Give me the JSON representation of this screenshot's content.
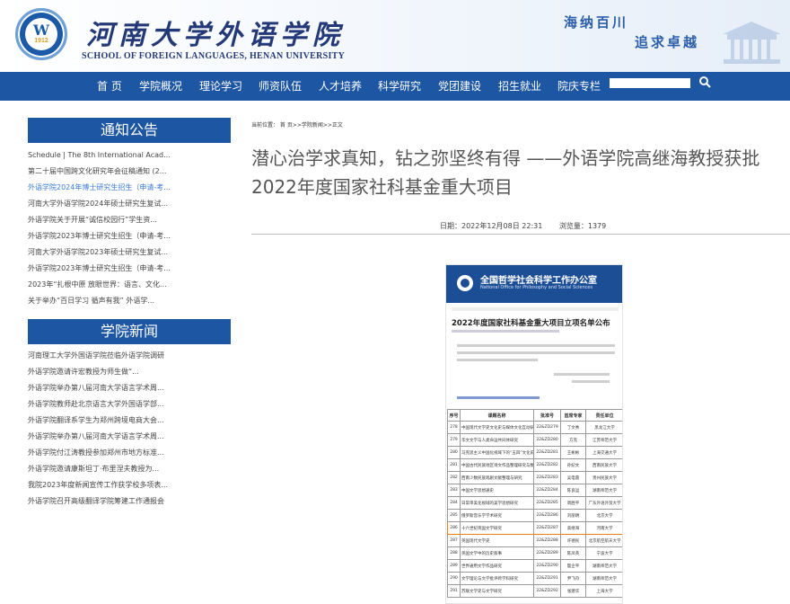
{
  "header": {
    "logo_year": "1912",
    "school_cn": "河南大学外语学院",
    "school_en": "SCHOOL OF FOREIGN LANGUAGES, HENAN UNIVERSITY",
    "slogan_1": "海纳百川",
    "slogan_2": "追求卓越"
  },
  "nav": {
    "items": [
      "首 页",
      "学院概况",
      "理论学习",
      "师资队伍",
      "人才培养",
      "科学研究",
      "党团建设",
      "招生就业",
      "院庆专栏"
    ],
    "search_value": ""
  },
  "sidebar": {
    "notice_title": "通知公告",
    "notices": [
      "Schedule | The 8th International Acad...",
      "第二十届中国跨文化研究年会征稿通知 (2...",
      "外语学院2024年博士研究生招生（申请-考...",
      "河南大学外语学院2024年硕士研究生复试...",
      "外语学院关于开展“诚信校园行”学生资...",
      "外语学院2023年博士研究生招生（申请-考...",
      "河南大学外语学院2023年硕士研究生复试...",
      "外语学院2023年博士研究生招生（申请-考...",
      "2023年“扎根中原 放眼世界：语言、文化...",
      "关于举办“百日学习 循声有我” 外语学..."
    ],
    "active_notice_index": 2,
    "news_title": "学院新闻",
    "news": [
      "河南理工大学外国语学院莅临外语学院调研",
      "外语学院邀请许宏教授为师生做“...",
      "外语学院举办第八届河南大学语言学术周...",
      "外语学院教师赴北京语言大学外国语学部...",
      "外语学院翻译系学生为郑州跨境电商大会...",
      "外语学院举办第八届河南大学语言学术周...",
      "外语学院付江涛教授参加郑州市地方标准...",
      "外语学院邀请康斯坦丁·布里涅夫教授为...",
      "我院2023年度新闻宣传工作获学校多项表...",
      "外语学院召开高级翻译学院筹建工作通报会"
    ]
  },
  "article": {
    "breadcrumb": "当前位置： 首 页>>学院新闻>>正文",
    "title": "潜心治学求真知，钻之弥坚终有得 ——外语学院高继海教授获批2022年度国家社科基金重大项目",
    "date": "日期：2022年12月08日 22:31",
    "views": "浏览量：1379"
  },
  "document": {
    "org": "全国哲学社会科学工作办公室",
    "org_en": "National Office for Philosophy and Social Sciences",
    "title": "2022年度国家社科基金重大项目立项名单公布",
    "headers": [
      "序号",
      "课题名称",
      "批准号",
      "首席专家",
      "责任单位"
    ],
    "rows": [
      [
        "278",
        "中国现代文学史文化史与媒体文化互动研究",
        "22&ZD279",
        "丁文秀",
        "黑龙江大学"
      ],
      [
        "279",
        "华文文学与人类命运共同体研究",
        "22&ZD280",
        "方克",
        "江苏师范大学"
      ],
      [
        "280",
        "马克思主义中国化视域下的“五四”文化史研究",
        "22&ZD281",
        "王彬彬",
        "上海交通大学"
      ],
      [
        "281",
        "中国古代民族地区诗文作品整理研究与数据库建设",
        "22&ZD282",
        "孙纪文",
        "西南民族大学"
      ],
      [
        "282",
        "西南少数民族戏剧文献整理与研究",
        "22&ZD283",
        "吴电雷",
        "贵州民族大学"
      ],
      [
        "283",
        "中国文学思想通史",
        "22&ZD284",
        "陈良运",
        "湖南师范大学"
      ],
      [
        "284",
        "日常审美化视域的美学思想研究",
        "22&ZD285",
        "周胜平",
        "广东外语外贸大学"
      ],
      [
        "285",
        "俄罗斯音乐学学术研究",
        "22&ZD286",
        "刘丽明",
        "北京大学"
      ],
      [
        "286",
        "十六世纪英国文学研究",
        "22&ZD287",
        "高继海",
        "河南大学"
      ],
      [
        "287",
        "英国现代文学史",
        "22&ZD288",
        "许德民",
        "北京航空航天大学"
      ],
      [
        "288",
        "英国文学中的历史叙事",
        "22&ZD289",
        "陈凤英",
        "宁波大学"
      ],
      [
        "289",
        "世界通用文学作品研究",
        "22&ZD290",
        "殷企平",
        "湖南师范大学"
      ],
      [
        "290",
        "文学理论与文学批评跨学科研究",
        "22&ZD291",
        "尹飞舟",
        "湖南师范大学"
      ],
      [
        "291",
        "苏联文学史与文学研究",
        "22&ZD292",
        "张建华",
        "上海大学"
      ]
    ],
    "highlight_index": 8
  }
}
